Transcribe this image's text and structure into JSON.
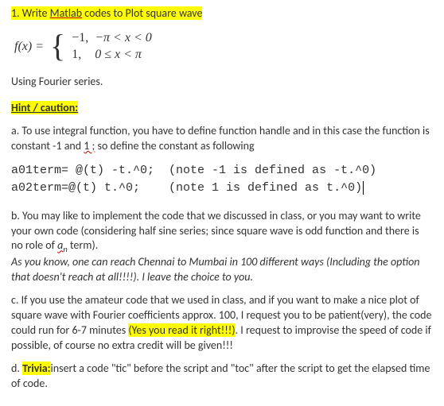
{
  "title": {
    "hl_part": "1. Write Matlab codes to Plot square wave",
    "underline_word": "Matlab"
  },
  "equation": {
    "fx": "f(x) =",
    "row1_val": "−1,",
    "row1_cond": "−π < x < 0",
    "row2_val": "1,",
    "row2_cond": "0 ≤ x < π"
  },
  "using_line": "Using Fourier series.",
  "hint_label": "Hint / caution:",
  "item_a": {
    "prefix": "a. To use integral function, you have to define function handle and in this case the function is constant -1 and ",
    "wavy": "1 ;",
    "suffix": " so define the constant as following"
  },
  "code": {
    "line1": "a01term= @(t) -t.^0;  (note -1 is defined as -t.^0)",
    "line2": "a02term=@(t) t.^0;    (note 1 is defined as t.^0)"
  },
  "item_b": {
    "line1_prefix": "b. You may like to implement the code that we discussed in class, or you may want to write your own code (considering half sine series; since square wave is odd function and there is no role of ",
    "an_a": "a",
    "an_n": "n",
    "line1_suffix": " term).",
    "line2": "As you know, one can reach Chennai to Mumbai in 100 different ways (Including the option that doesn't reach at all!!!!). I leave the choice to you."
  },
  "item_c": {
    "pre": "c. If you use the amateur code that we used in class, and if you want to make a nice plot of square wave with Fourier coefficients approx. 100, I request you to be patient(very), the code could run for 6-7 minutes ",
    "hl": "(Yes you read it right!!!)",
    "post": ". I request to improvise the speed of code if possible, of course no extra credit will be given!!!"
  },
  "item_d": {
    "prefix": "d. ",
    "hl": "Trivia:",
    "suffix": "insert a code \"tic\" before the script and \"toc\" after the script to get the elapsed time of code."
  }
}
